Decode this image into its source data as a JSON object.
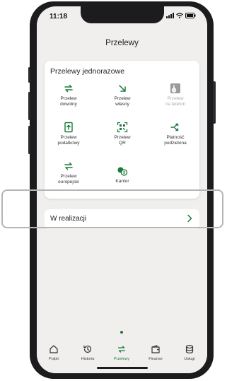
{
  "status_bar": {
    "time": "11:18"
  },
  "header": {
    "title": "Przelewy"
  },
  "one_time_transfers": {
    "title": "Przelewy jednorazowe",
    "tiles": [
      {
        "label_line1": "Przelew",
        "label_line2": "dowolny",
        "icon": "arrows-swap-icon",
        "enabled": true
      },
      {
        "label_line1": "Przelew",
        "label_line2": "własny",
        "icon": "arrow-down-right-icon",
        "enabled": true
      },
      {
        "label_line1": "Przelew",
        "label_line2": "na telefon",
        "icon": "blik-icon",
        "enabled": false
      },
      {
        "label_line1": "Przelew",
        "label_line2": "podatkowy",
        "icon": "tax-document-icon",
        "enabled": true
      },
      {
        "label_line1": "Przelew",
        "label_line2": "QR",
        "icon": "qr-code-icon",
        "enabled": true
      },
      {
        "label_line1": "Płatność",
        "label_line2": "podzielona",
        "icon": "split-payment-icon",
        "enabled": true
      },
      {
        "label_line1": "Przelew",
        "label_line2": "europejski",
        "icon": "arrows-swap-icon",
        "enabled": true
      },
      {
        "label_line1": "Kantor",
        "label_line2": "",
        "icon": "currency-exchange-icon",
        "enabled": true
      }
    ]
  },
  "in_progress": {
    "label": "W realizacji"
  },
  "tab_bar": {
    "items": [
      {
        "label": "Pulpit",
        "icon": "home-icon"
      },
      {
        "label": "Historia",
        "icon": "history-icon"
      },
      {
        "label": "Przelewy",
        "icon": "transfers-icon",
        "active": true
      },
      {
        "label": "Finanse",
        "icon": "wallet-icon"
      },
      {
        "label": "Usługi",
        "icon": "services-icon"
      }
    ]
  },
  "colors": {
    "accent": "#1a7a3a",
    "background": "#f0efee",
    "frame": "#1c1c1e"
  }
}
